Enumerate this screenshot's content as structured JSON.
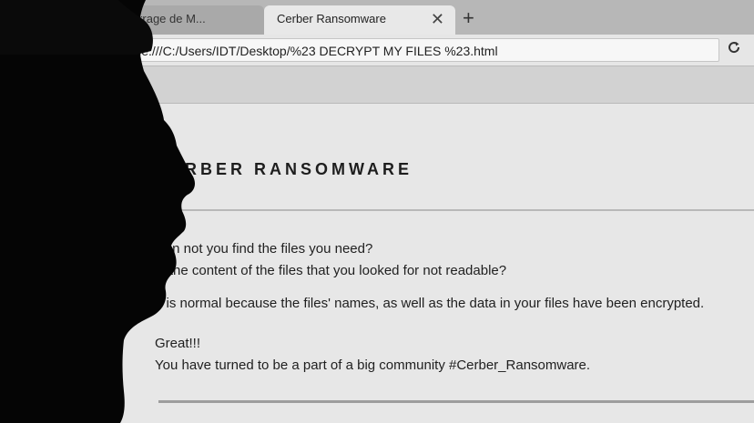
{
  "browser": {
    "tabs": [
      {
        "label": "marrage de M..."
      },
      {
        "label": "Cerber Ransomware"
      }
    ],
    "new_tab_label": "+",
    "close_glyph": "✕",
    "address": "ile:///C:/Users/IDT/Desktop/%23 DECRYPT MY FILES %23.html",
    "reload_icon": "reload-icon"
  },
  "page": {
    "title": "CERBER RANSOMWARE",
    "lines_1": [
      "Can not you find the files you need?",
      "Is the content of the files that you looked for not readable?"
    ],
    "line_2": "It is normal because the files' names, as well as the data in your files have been encrypted.",
    "lines_3": [
      "Great!!!",
      "You have turned to be a part of a big community #Cerber_Ransomware."
    ]
  }
}
